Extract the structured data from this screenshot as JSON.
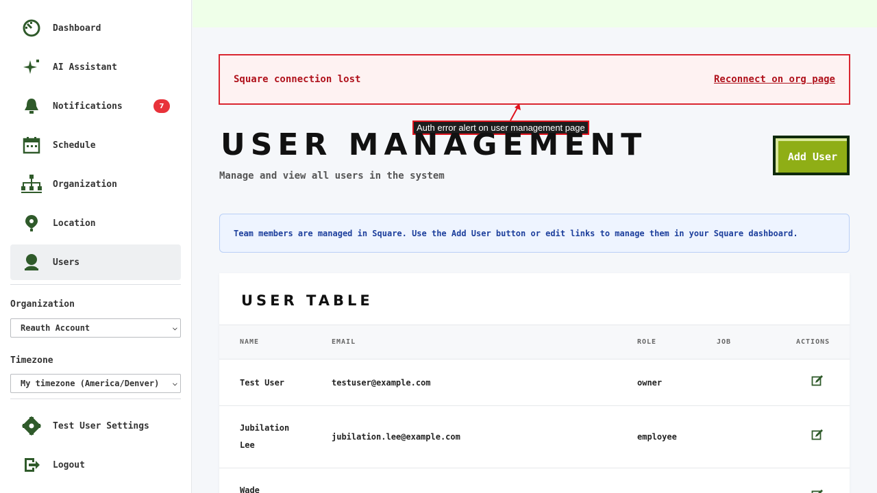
{
  "sidebar": {
    "items": [
      {
        "label": "Dashboard",
        "icon": "dashboard-icon"
      },
      {
        "label": "AI Assistant",
        "icon": "sparkle-icon"
      },
      {
        "label": "Notifications",
        "icon": "bell-icon",
        "badge": "7"
      },
      {
        "label": "Schedule",
        "icon": "calendar-icon"
      },
      {
        "label": "Organization",
        "icon": "org-chart-icon"
      },
      {
        "label": "Location",
        "icon": "location-pin-icon"
      },
      {
        "label": "Users",
        "icon": "user-icon",
        "active": true
      }
    ],
    "organization_label": "Organization",
    "organization_value": "Reauth Account",
    "timezone_label": "Timezone",
    "timezone_value": "My timezone (America/Denver)",
    "settings_label": "Test User Settings",
    "logout_label": "Logout"
  },
  "alert": {
    "message": "Square connection lost",
    "link": "Reconnect on org page",
    "annotation": "Auth error alert on user management page"
  },
  "header": {
    "title": "User Management",
    "subtitle": "Manage and view all users in the system",
    "add_user_label": "Add User"
  },
  "info_banner": "Team members are managed in Square. Use the Add User button or edit links to manage them in your Square dashboard.",
  "table": {
    "title": "User Table",
    "columns": [
      "Name",
      "Email",
      "Role",
      "Job",
      "Actions"
    ],
    "rows": [
      {
        "name": "Test User",
        "email": "testuser@example.com",
        "role": "owner",
        "job": ""
      },
      {
        "name": "Jubilation Lee",
        "email": "jubilation.lee@example.com",
        "role": "employee",
        "job": ""
      },
      {
        "name": "Wade",
        "email": "",
        "role": "",
        "job": ""
      }
    ]
  },
  "colors": {
    "accent_green": "#8fae16",
    "alert_red": "#d9252f",
    "sidebar_icon": "#2f5a2a",
    "topbar": "#efffe9"
  }
}
